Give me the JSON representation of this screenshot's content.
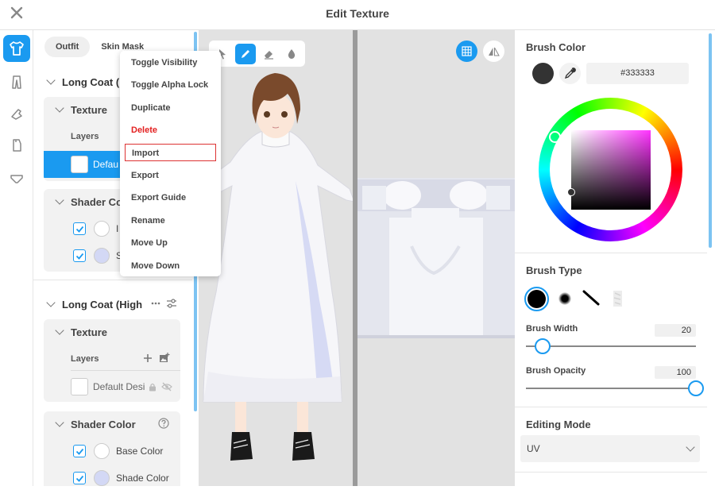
{
  "window": {
    "title": "Edit Texture"
  },
  "colors": {
    "accent": "#1a9af0",
    "danger": "#e32020",
    "brush": "#333333"
  },
  "rail": {
    "icons": [
      "shirt-icon",
      "pants-icon",
      "shoe-icon",
      "boot-icon",
      "underwear-icon"
    ]
  },
  "layer_panel": {
    "tabs": [
      "Outfit",
      "Skin Mask"
    ],
    "groups": [
      {
        "name": "Long Coat (H",
        "texture_title": "Texture",
        "layers_label": "Layers",
        "layer_name": "Defau",
        "shader_title": "Shader Co",
        "options": [
          "I",
          "S"
        ]
      },
      {
        "name": "Long Coat (High",
        "texture_title": "Texture",
        "layers_label": "Layers",
        "layer_name": "Default Desi",
        "shader_title": "Shader Color",
        "options": [
          "Base Color",
          "Shade Color"
        ]
      }
    ]
  },
  "context_menu": {
    "items": [
      "Toggle Visibility",
      "Toggle Alpha Lock",
      "Duplicate",
      "Delete",
      "Import",
      "Export",
      "Export Guide",
      "Rename",
      "Move Up",
      "Move Down"
    ]
  },
  "right_panel": {
    "brush_color": {
      "title": "Brush Color",
      "hex": "#333333"
    },
    "brush_type": {
      "title": "Brush Type"
    },
    "brush_width": {
      "label": "Brush Width",
      "value": "20",
      "fraction": 0.1
    },
    "brush_opacity": {
      "label": "Brush Opacity",
      "value": "100",
      "fraction": 1.0
    },
    "editing_mode": {
      "title": "Editing Mode",
      "value": "UV"
    }
  }
}
